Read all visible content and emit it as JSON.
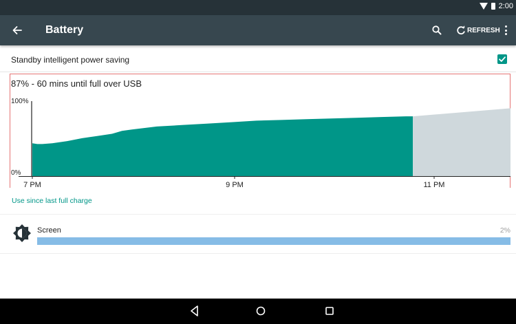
{
  "status_bar": {
    "time": "2:00",
    "icons": [
      "wifi-icon",
      "battery-icon"
    ]
  },
  "app_bar": {
    "title": "Battery",
    "back_icon": "arrow-back-icon",
    "search_icon": "search-icon",
    "refresh_label": "REFRESH",
    "refresh_icon": "refresh-icon",
    "overflow_icon": "more-vert-icon",
    "background": "#37474f"
  },
  "standby": {
    "label": "Standby intelligent power saving",
    "checked": true
  },
  "chart": {
    "status_text": "87% - 60 mins until full over USB"
  },
  "chart_data": {
    "type": "area",
    "title": "87% - 60 mins until full over USB",
    "y_tick_labels": [
      "100%",
      "0%"
    ],
    "ylim": [
      0,
      100
    ],
    "x_tick_labels": [
      "7 PM",
      "9 PM",
      "11 PM"
    ],
    "series": [
      {
        "name": "",
        "color": "#009688",
        "x": [
          0.0,
          0.05,
          0.1,
          0.2,
          0.35,
          0.5,
          0.65,
          0.8,
          0.85,
          0.9,
          1.0,
          1.25,
          1.5,
          1.75,
          2.0,
          2.25,
          2.5,
          2.75,
          3.0,
          3.25,
          3.5,
          3.75,
          3.82
        ],
        "values": [
          45,
          44,
          44,
          45,
          48,
          52,
          55,
          58,
          60,
          62,
          64,
          68,
          70,
          72,
          74,
          76,
          77,
          78,
          79,
          80,
          81,
          82,
          82
        ]
      },
      {
        "name": "",
        "color": "#cfd8dc",
        "x": [
          3.82,
          4.8
        ],
        "values": [
          82,
          93
        ]
      }
    ]
  },
  "usage": {
    "section_link": "Use since last full charge",
    "items": [
      {
        "label": "Screen",
        "percent_text": "2%",
        "fraction": 1.0,
        "icon": "brightness-icon",
        "bar_color": "#86bce6"
      }
    ]
  },
  "nav_bar": {
    "icons": [
      "nav-back-icon",
      "nav-home-icon",
      "nav-recents-icon"
    ]
  }
}
